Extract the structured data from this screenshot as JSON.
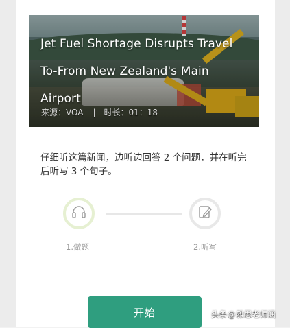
{
  "article": {
    "title": "Jet Fuel Shortage Disrupts Travel To-From New Zealand's Main Airport",
    "source": "来源：VOA",
    "separator": "|",
    "duration": "时长：01：18"
  },
  "instruction": "仔细听这篇新闻，边听边回答 2 个问题，并在听完后听写 3 个句子。",
  "steps": [
    {
      "label": "1.做题",
      "icon": "headphones-icon",
      "state": "active"
    },
    {
      "label": "2.听写",
      "icon": "pencil-note-icon",
      "state": "inactive"
    }
  ],
  "start_button": "开始",
  "watermark": {
    "prefix": "头条",
    "at": "@",
    "handle": "雅思老师涵"
  },
  "colors": {
    "accent": "#2f9e7f",
    "step_active_ring": "#e6f0d2",
    "step_inactive_ring": "#e8e8e8"
  }
}
